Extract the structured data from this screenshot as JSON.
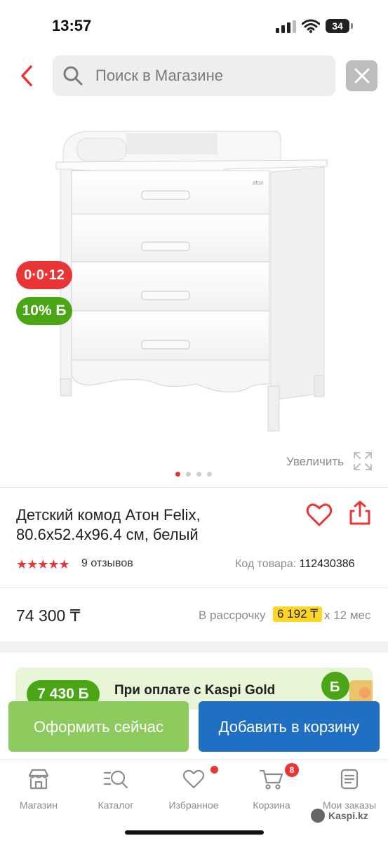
{
  "status_bar": {
    "time": "13:57",
    "battery": "34"
  },
  "header": {
    "search_placeholder": "Поиск в Магазине"
  },
  "gallery": {
    "badge_installment": "0·0·12",
    "badge_bonus": "10% Б",
    "zoom_label": "Увеличить",
    "page_count": 4,
    "active_page": 1
  },
  "product": {
    "title": "Детский комод Атон Felix, 80.6x52.4x96.4 см, белый",
    "stars": "★★★★★",
    "rating": 5,
    "reviews": "9 отзывов",
    "code_label": "Код товара:",
    "code_value": "112430386"
  },
  "price": {
    "value": "74 300 ₸",
    "installment_label": "В рассрочку",
    "installment_value": "6 192 ₸",
    "installment_term": "x 12 мес"
  },
  "promo": {
    "bonus": "7 430 Б",
    "text": "При оплате с Kaspi Gold"
  },
  "actions": {
    "buy_now": "Оформить сейчас",
    "add_to_cart": "Добавить в корзину"
  },
  "tabbar": {
    "items": [
      {
        "label": "Магазин",
        "icon": "store-icon"
      },
      {
        "label": "Каталог",
        "icon": "catalog-search-icon"
      },
      {
        "label": "Избранное",
        "icon": "heart-icon"
      },
      {
        "label": "Корзина",
        "icon": "cart-icon"
      },
      {
        "label": "Мои заказы",
        "icon": "orders-icon"
      }
    ],
    "cart_count": "8"
  },
  "watermark": "Kaspi.kz",
  "colors": {
    "brand_red": "#e93535",
    "green": "#4aa614",
    "blue": "#1f6fc5",
    "installment_yellow": "#ffd626"
  }
}
